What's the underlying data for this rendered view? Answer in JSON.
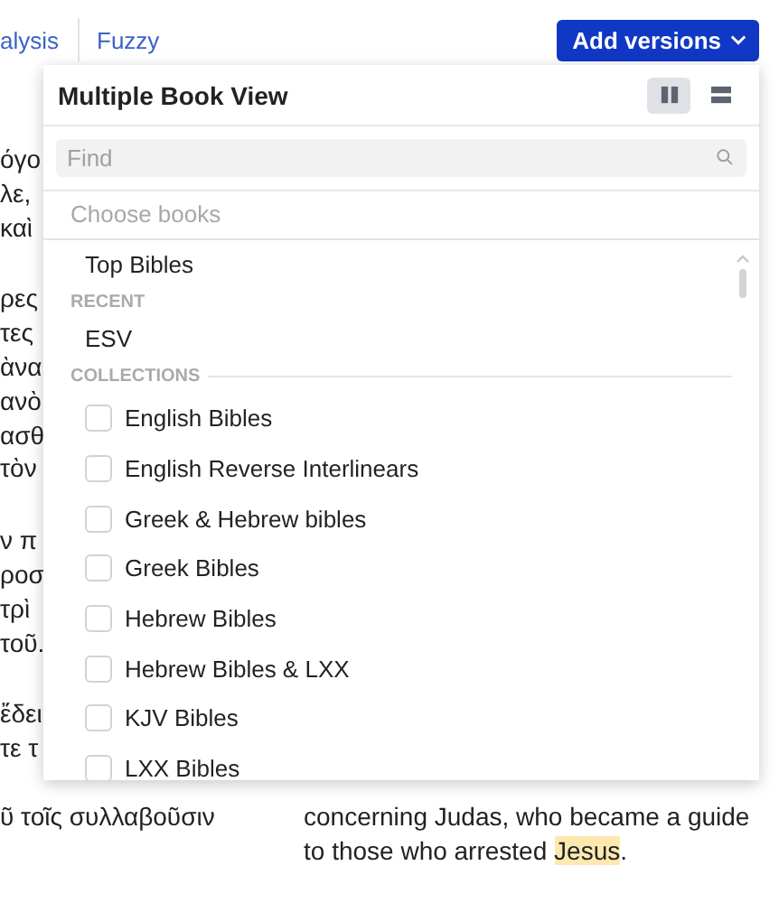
{
  "tabs": [
    {
      "label": "alysis"
    },
    {
      "label": "Fuzzy"
    }
  ],
  "add_versions_button": {
    "label": "Add versions"
  },
  "verses": [
    {
      "greek": [
        "όγο",
        "λε,",
        "καὶ"
      ]
    },
    {
      "greek": [
        "ρες",
        "τες",
        "ὰνα",
        "ανὸ",
        "ασθ",
        "τὸν"
      ]
    },
    {
      "greek": [
        "ν π",
        "ροσ",
        "τρὶ",
        "τοῦ."
      ]
    },
    {
      "greek": [
        "ἔδει",
        "τε τ",
        "ῦ τοῖς συλλαβοῦσιν"
      ],
      "english": [
        "concerning Judas, who became a guide",
        "to those who arrested **Jesus**."
      ]
    }
  ],
  "popup": {
    "title": "Multiple Book View",
    "view_modes": [
      {
        "kind": "columns",
        "selected": true
      },
      {
        "kind": "rows",
        "selected": false
      }
    ],
    "search": {
      "placeholder": "Find"
    },
    "choose_books": "Choose books",
    "top_item": "Top Bibles",
    "sections": [
      {
        "heading": "RECENT",
        "kind": "plain",
        "items": [
          {
            "label": "ESV"
          }
        ]
      },
      {
        "heading": "COLLECTIONS",
        "kind": "checkbox",
        "items": [
          {
            "label": "English Bibles",
            "checked": false
          },
          {
            "label": "English Reverse Interlinears",
            "checked": false
          },
          {
            "label": "Greek & Hebrew bibles",
            "checked": false
          },
          {
            "label": "Greek Bibles",
            "checked": false
          },
          {
            "label": "Hebrew Bibles",
            "checked": false
          },
          {
            "label": "Hebrew Bibles & LXX",
            "checked": false
          },
          {
            "label": "KJV Bibles",
            "checked": false
          },
          {
            "label": "LXX Bibles",
            "checked": false
          }
        ]
      }
    ]
  }
}
